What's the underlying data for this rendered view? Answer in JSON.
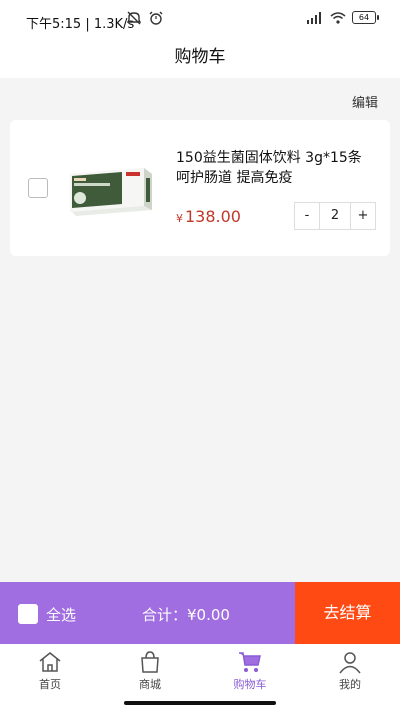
{
  "status_bar": {
    "time": "下午5:15",
    "speed": "1.3K/s",
    "battery": "64"
  },
  "header": {
    "title": "购物车",
    "edit_label": "编辑"
  },
  "cart": {
    "items": [
      {
        "title": "150益生菌固体饮料 3g*15条 呵护肠道 提高免疫",
        "currency": "¥",
        "price": "138.00",
        "quantity": "2",
        "minus": "-",
        "plus": "+"
      }
    ]
  },
  "checkout": {
    "select_all": "全选",
    "total_label": "合计：",
    "total_value": "¥0.00",
    "button": "去结算"
  },
  "tabs": [
    {
      "label": "首页",
      "icon": "home-icon"
    },
    {
      "label": "商城",
      "icon": "shopping-bag-icon"
    },
    {
      "label": "购物车",
      "icon": "cart-icon",
      "active": true
    },
    {
      "label": "我的",
      "icon": "user-icon"
    }
  ],
  "colors": {
    "accent": "#a06ee0",
    "checkout": "#ff4a14",
    "price": "#c0392b"
  }
}
